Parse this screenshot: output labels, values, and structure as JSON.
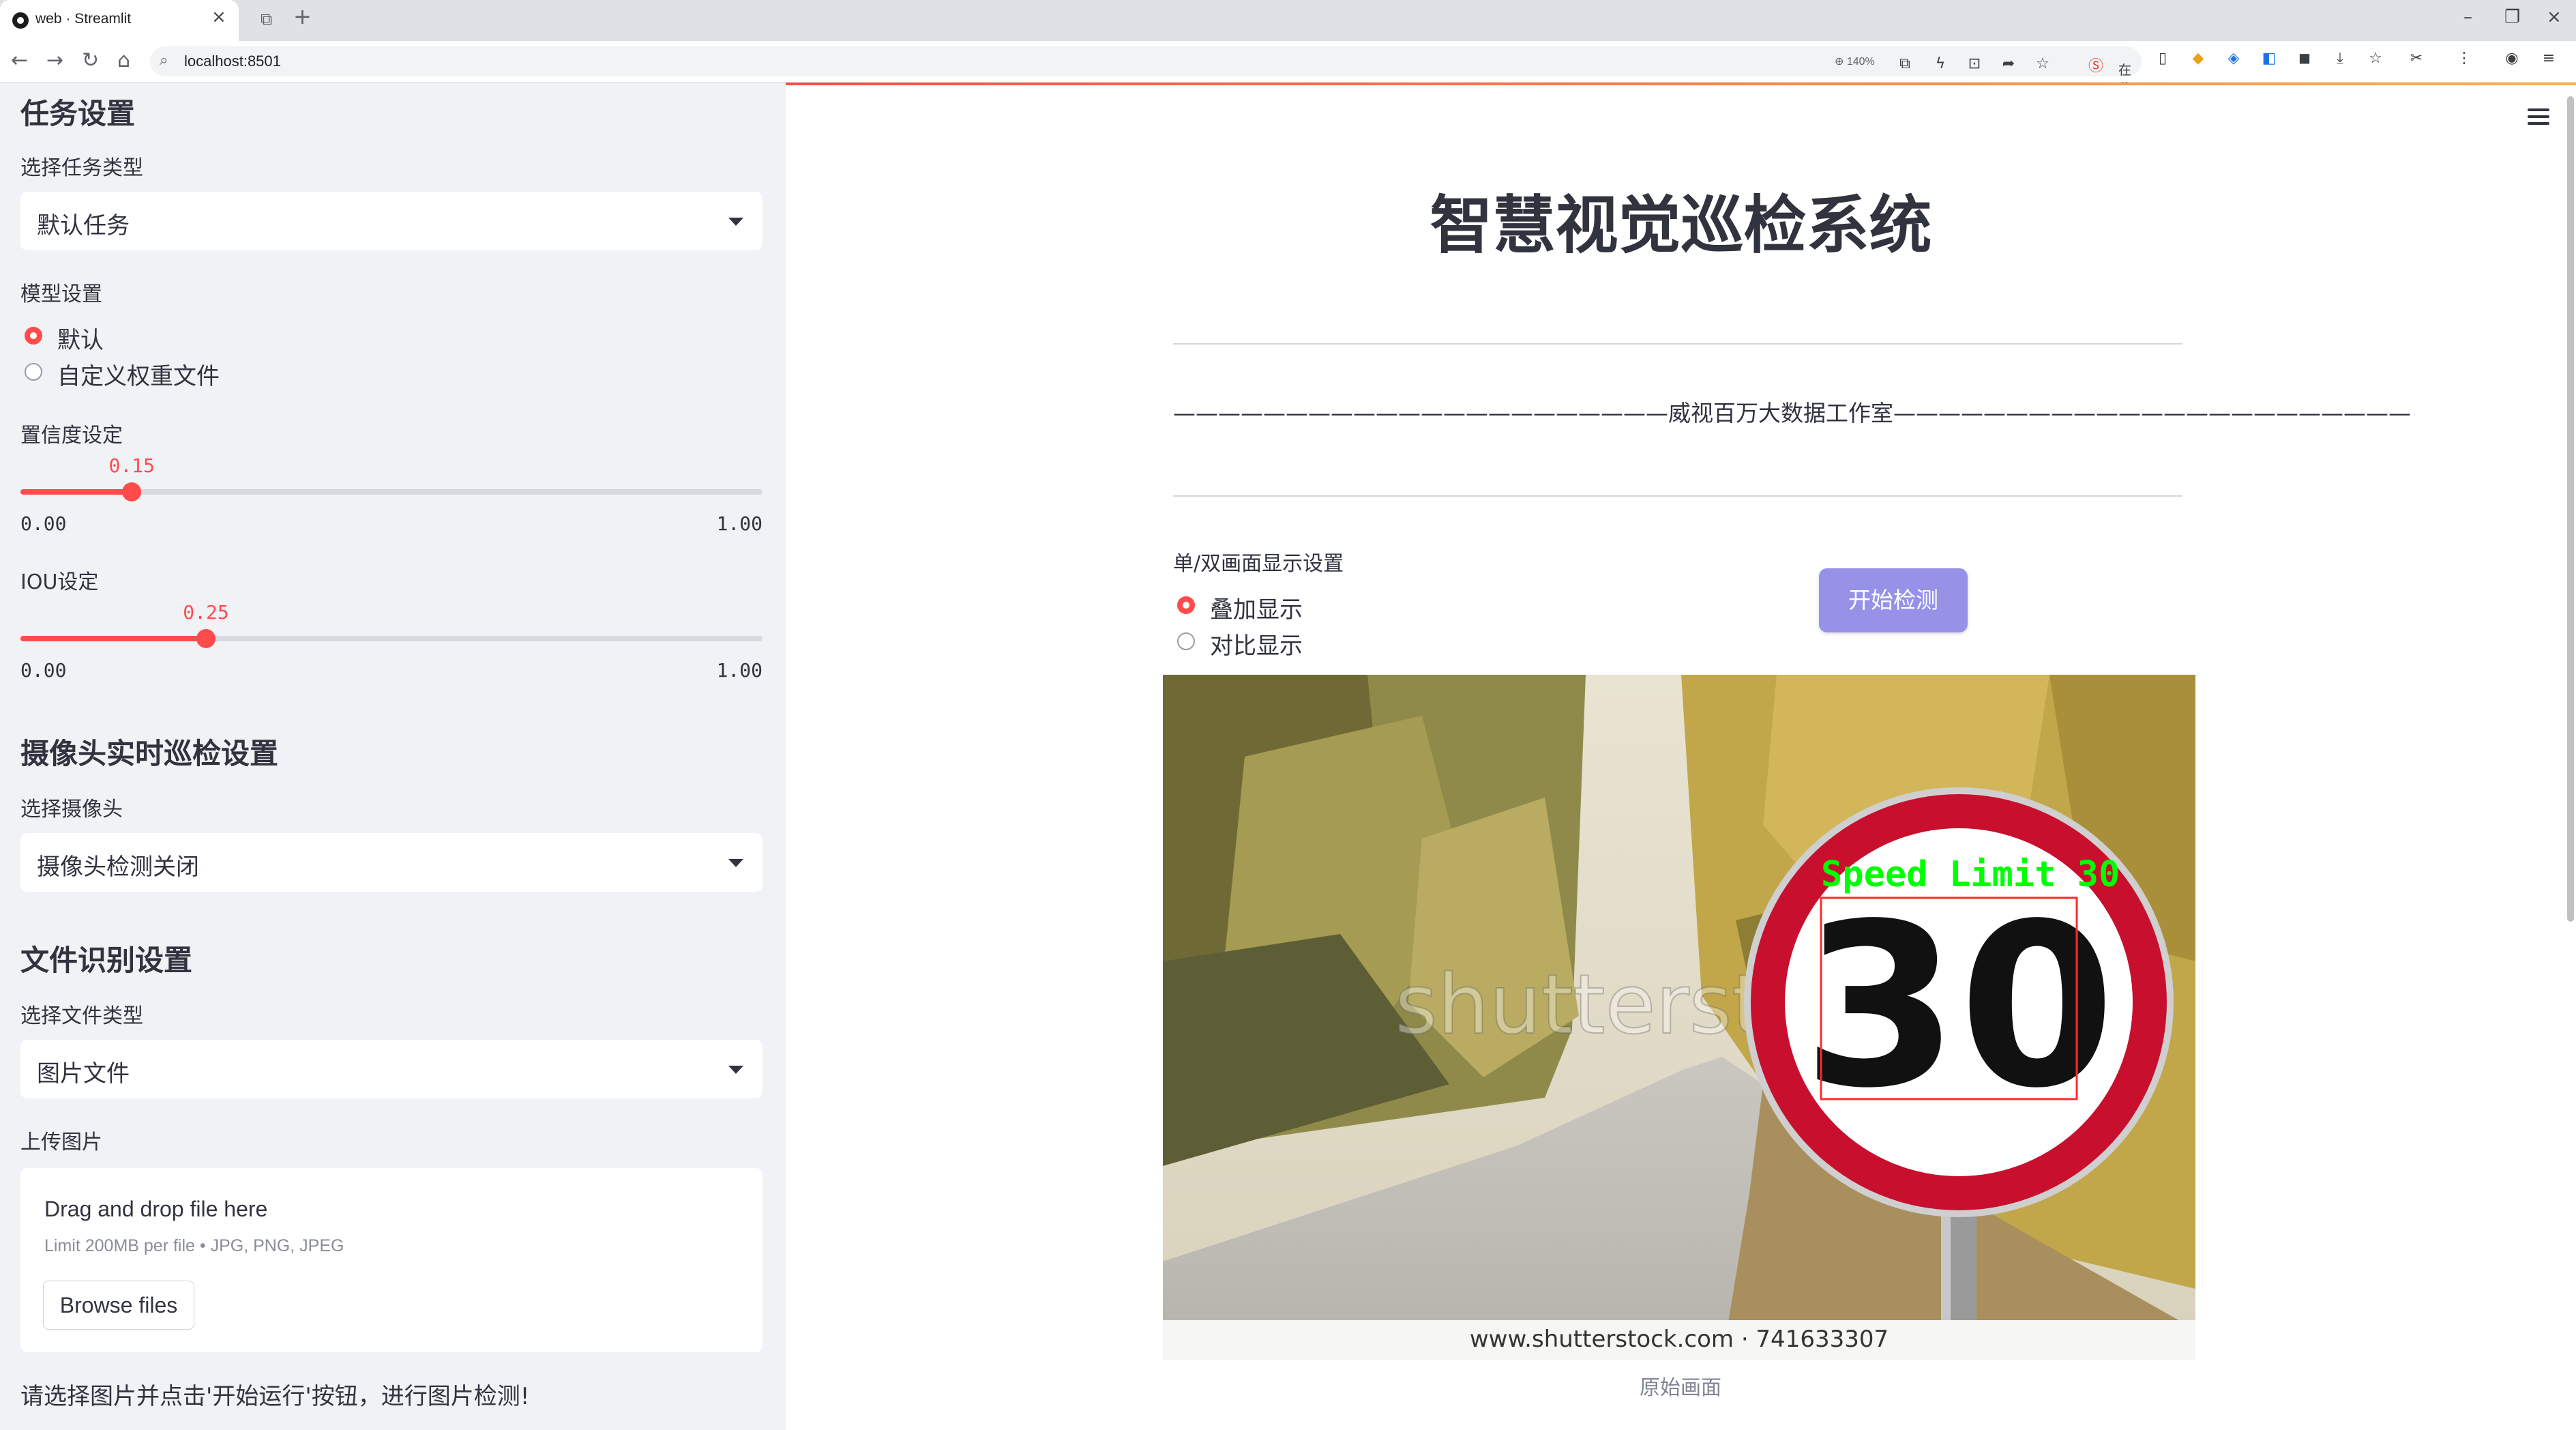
{
  "browser": {
    "tab_title": "web · Streamlit",
    "url": "localhost:8501",
    "zoom": "140%",
    "search_label": "在此搜索"
  },
  "sidebar": {
    "task_section": {
      "heading": "任务设置",
      "select_label": "选择任务类型",
      "select_value": "默认任务"
    },
    "model": {
      "label": "模型设置",
      "options": [
        "默认",
        "自定义权重文件"
      ],
      "selected": 0
    },
    "confidence": {
      "label": "置信度设定",
      "value": "0.15",
      "fraction": 0.15,
      "min": "0.00",
      "max": "1.00"
    },
    "iou": {
      "label": "IOU设定",
      "value": "0.25",
      "fraction": 0.25,
      "min": "0.00",
      "max": "1.00"
    },
    "camera_section": {
      "heading": "摄像头实时巡检设置",
      "select_label": "选择摄像头",
      "select_value": "摄像头检测关闭"
    },
    "file_section": {
      "heading": "文件识别设置",
      "select_label": "选择文件类型",
      "select_value": "图片文件",
      "upload_label": "上传图片",
      "drop_title": "Drag and drop file here",
      "drop_limit": "Limit 200MB per file • JPG, PNG, JPEG",
      "browse_label": "Browse files"
    },
    "hint": "请选择图片并点击'开始运行'按钮，进行图片检测!"
  },
  "main": {
    "title": "智慧视觉巡检系统",
    "subtitle": "——————————————————————威视百万大数据工作室———————————————————————",
    "display": {
      "label": "单/双画面显示设置",
      "options": [
        "叠加显示",
        "对比显示"
      ],
      "selected": 0
    },
    "start_button": "开始检测",
    "image": {
      "detection_label": "Speed Limit 30",
      "sign_number": "30",
      "watermark": "shutterstock",
      "footer": "www.shutterstock.com · 741633307"
    },
    "caption": "原始画面"
  },
  "colors": {
    "accent": "#ff4b4b",
    "button": "#9592e8",
    "sidebar_bg": "#f0f2f6",
    "detection_box": "#ff2a2a",
    "detection_text": "#00ff00"
  }
}
